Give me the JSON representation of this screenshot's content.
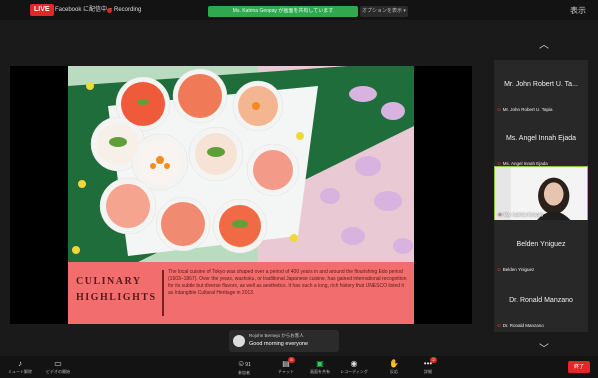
{
  "topbar": {
    "live_label": "LIVE",
    "facebook_label": "Facebook に配信中 ▾",
    "recording_label": "Recording",
    "speaking_label": "Ms. Katrina Geopay が画面を共有しています",
    "view_label": "オプションを表示 ▾",
    "view_icon": "表示"
  },
  "slide": {
    "title": "CULINARY HIGHLIGHTS",
    "body": "The local cuisine of Tokyo was shaped over a period of 400 years in and around the flourishing Edo period (1603–1867). Over the years, washoku, or traditional Japanese cuisine, has gained international recognition for its subtle but diverse flavors, as well as aesthetics. It has such a long, rich history that UNESCO listed it as Intangible Cultural Heritage in 2013."
  },
  "participants": [
    {
      "name": "Mr. John Robert U. Ta...",
      "footer": "Mr. John Robert U. Tapia"
    },
    {
      "name": "Ms. Angel Innah Ejada",
      "footer": "Ms. Angel Innah Ejada"
    },
    {
      "name": "",
      "footer": "Ms. Katrina Geopay"
    },
    {
      "name": "Belden Yniguez",
      "footer": "Belden Yniguez"
    },
    {
      "name": "Dr. Ronald Manzano",
      "footer": "Dr. Ronald Manzano"
    }
  ],
  "chat": {
    "sender": "Rojohn Bernejo からお客人",
    "message": "Good morning everyone"
  },
  "toolbar": {
    "items": [
      {
        "label": "ミュート解除",
        "badge": ""
      },
      {
        "label": "ビデオの開始",
        "badge": ""
      },
      {
        "label": "参加者",
        "badge": ""
      },
      {
        "label": "チャット",
        "badge": "5"
      },
      {
        "label": "画面を共有",
        "badge": ""
      },
      {
        "label": "レコーディング",
        "badge": ""
      },
      {
        "label": "反応",
        "badge": ""
      },
      {
        "label": "詳細",
        "badge": "2"
      }
    ],
    "participant_count": "91",
    "end_label": "終了"
  },
  "colors": {
    "caption_bg": "#f26e6e",
    "active_speaker_border": "#8dc63f",
    "live_red": "#e02828",
    "speaking_green": "#2fa84f"
  }
}
